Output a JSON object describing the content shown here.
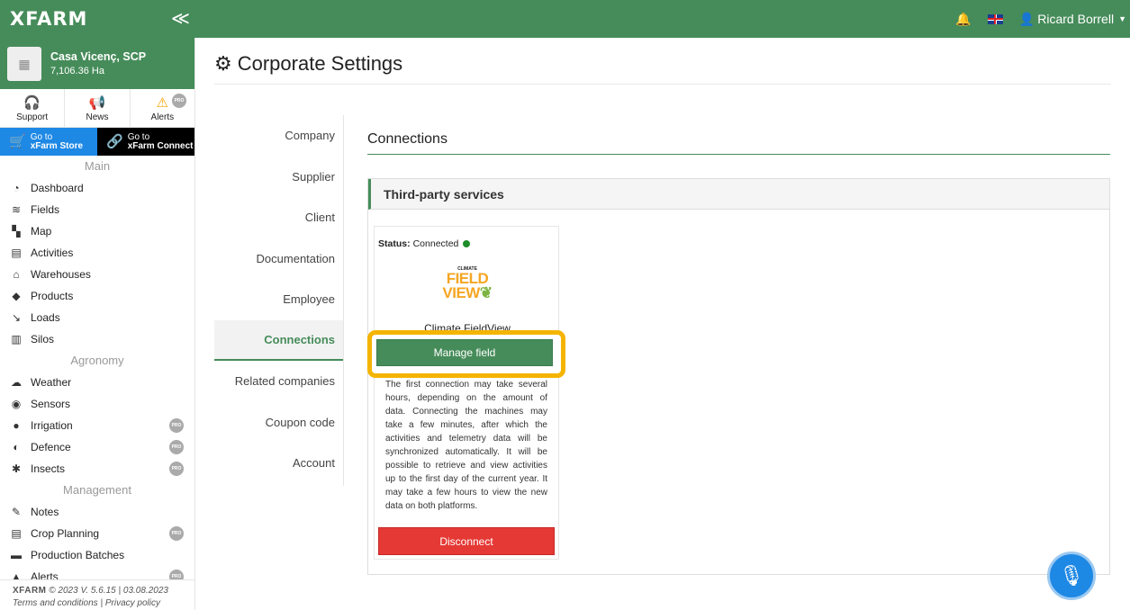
{
  "topbar": {
    "logo": "XFARM",
    "collapse_icon": "≪",
    "user_name": "Ricard Borrell"
  },
  "sidebar": {
    "farm_name": "Casa Vicenç, SCP",
    "farm_area": "7,106.36 Ha",
    "quick": [
      {
        "label": "Support",
        "icon": "headset-icon"
      },
      {
        "label": "News",
        "icon": "megaphone-icon"
      },
      {
        "label": "Alerts",
        "icon": "warning-icon"
      }
    ],
    "store_label": "Go to\nxFarm Store",
    "store_line1": "Go to",
    "store_line2": "xFarm Store",
    "connect_line1": "Go to",
    "connect_line2": "xFarm Connect",
    "section_main": "Main",
    "main_items": [
      "Dashboard",
      "Fields",
      "Map",
      "Activities",
      "Warehouses",
      "Products",
      "Loads",
      "Silos"
    ],
    "section_agronomy": "Agronomy",
    "agronomy_items": [
      "Weather",
      "Sensors",
      "Irrigation",
      "Defence",
      "Insects"
    ],
    "section_management": "Management",
    "management_items": [
      "Notes",
      "Crop Planning",
      "Production Batches",
      "Alerts"
    ],
    "pro_label": "PRO",
    "footer_brand": "XFARM",
    "footer_version": "© 2023 V. 5.6.15 | 03.08.2023",
    "footer_terms": "Terms and conditions",
    "footer_privacy": "Privacy policy"
  },
  "page": {
    "title": "Corporate Settings",
    "menu": [
      "Company",
      "Supplier",
      "Client",
      "Documentation",
      "Employee",
      "Connections",
      "Related companies",
      "Coupon code",
      "Account"
    ],
    "active_menu": "Connections",
    "content_title": "Connections",
    "panel_title": "Third-party services",
    "card": {
      "status_label": "Status:",
      "status_value": "Connected",
      "status_color": "#1e8c2a",
      "logo_small": "CLIMATE",
      "logo_line1": "FIELD",
      "logo_line2": "VIEW",
      "service_name": "Climate FieldView",
      "manage_label": "Manage field",
      "description": "The first connection may take several hours, depending on the amount of data. Connecting the machines may take a few minutes, after which the activities and telemetry data will be synchronized automatically. It will be possible to retrieve and view activities up to the first day of the current year. It may take a few hours to view the new data on both platforms.",
      "disconnect_label": "Disconnect"
    }
  },
  "colors": {
    "brand_green": "#468c5a",
    "highlight": "#f4b400",
    "danger": "#e53935",
    "store_blue": "#1e88e5"
  }
}
